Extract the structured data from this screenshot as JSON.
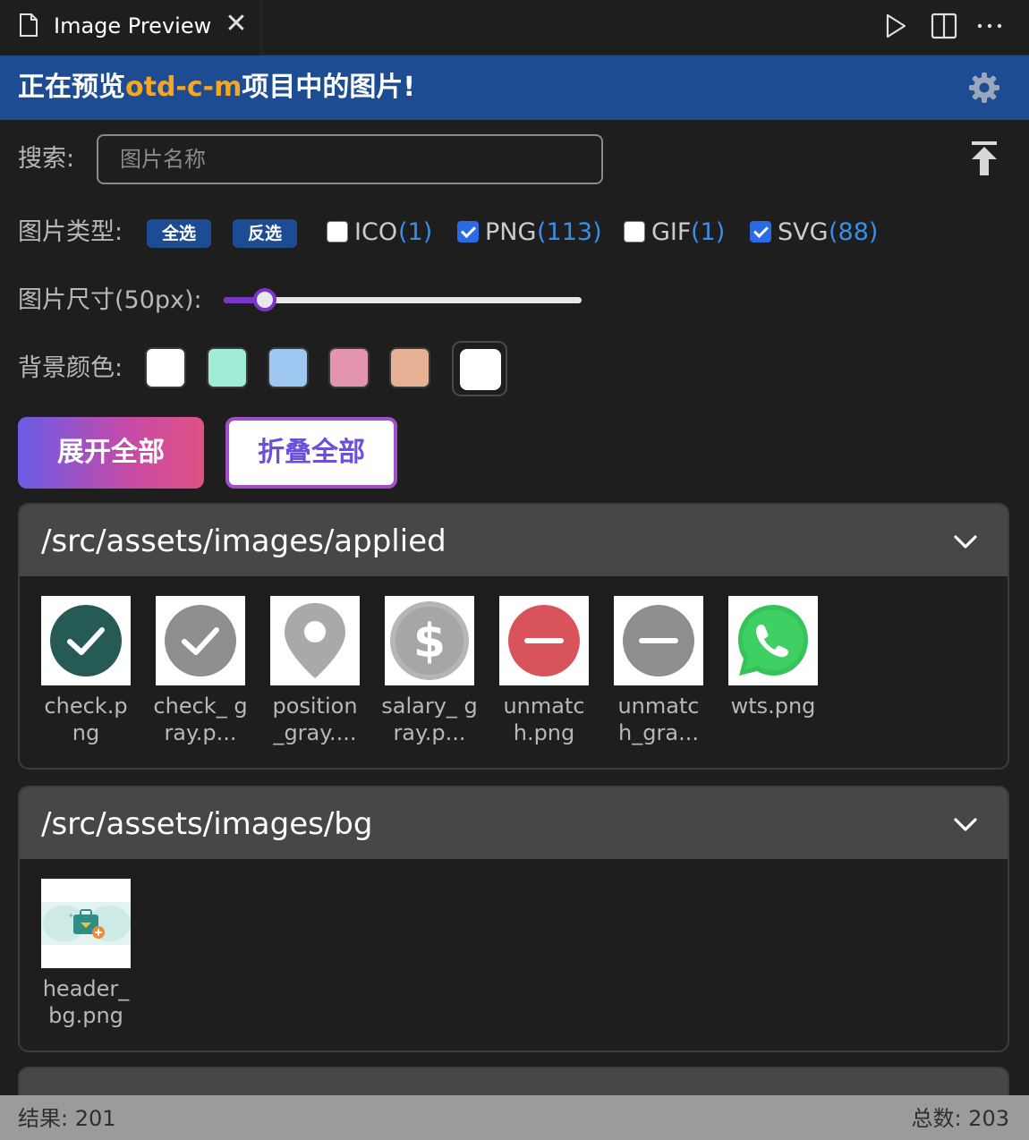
{
  "tab": {
    "title": "Image Preview",
    "close": "✕"
  },
  "toolbar": {
    "run": "run-icon",
    "split": "split-editor-icon",
    "more": "more-actions-icon"
  },
  "banner": {
    "prefix": "正在预览",
    "project": "otd-c-m",
    "suffix": "项目中的图片!"
  },
  "search": {
    "label": "搜索:",
    "placeholder": "图片名称",
    "value": ""
  },
  "types": {
    "label": "图片类型:",
    "select_all": "全选",
    "invert": "反选",
    "items": [
      {
        "name": "ICO",
        "count": "(1)",
        "checked": false
      },
      {
        "name": "PNG",
        "count": "(113)",
        "checked": true
      },
      {
        "name": "GIF",
        "count": "(1)",
        "checked": false
      },
      {
        "name": "SVG",
        "count": "(88)",
        "checked": true
      }
    ]
  },
  "size": {
    "label": "图片尺寸(50px):",
    "value": 50,
    "slider_fraction": 0.115
  },
  "background": {
    "label": "背景颜色:",
    "swatches": [
      "#ffffff",
      "#a0ecd9",
      "#9dc6f0",
      "#e495ae",
      "#e6b195"
    ],
    "selected": "#ffffff"
  },
  "actions": {
    "expand_all": "展开全部",
    "collapse_all": "折叠全部"
  },
  "folders": [
    {
      "path": "/src/assets/images/applied",
      "images": [
        {
          "name": "check.png",
          "label": "check.p ng",
          "icon": "check-circle-dark-green"
        },
        {
          "name": "check_gray.png",
          "label": "check_ gray.p...",
          "icon": "check-circle-gray"
        },
        {
          "name": "position_gray.png",
          "label": "position _gray....",
          "icon": "map-pin-gray"
        },
        {
          "name": "salary_gray.png",
          "label": "salary_ gray.p...",
          "icon": "dollar-circle-gray"
        },
        {
          "name": "unmatch.png",
          "label": "unmatc h.png",
          "icon": "minus-circle-red"
        },
        {
          "name": "unmatch_gray.png",
          "label": "unmatc h_gra...",
          "icon": "minus-circle-gray"
        },
        {
          "name": "wts.png",
          "label": "wts.png",
          "icon": "whatsapp-logo"
        }
      ]
    },
    {
      "path": "/src/assets/images/bg",
      "images": [
        {
          "name": "header_bg.png",
          "label": "header_ bg.png",
          "icon": "briefcase-illustration"
        }
      ]
    }
  ],
  "status": {
    "result": "结果: 201",
    "total": "总数: 203"
  },
  "colors": {
    "banner": "#1d4c92",
    "project": "#f5a623",
    "accent": "#2a6ae4",
    "count": "#3a8ee6",
    "slider": "#7a36c9"
  }
}
